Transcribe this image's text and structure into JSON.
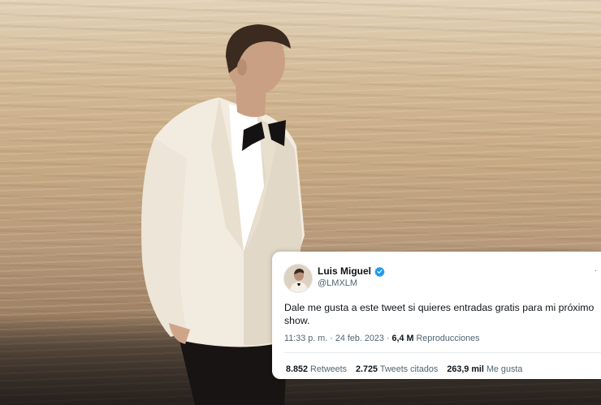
{
  "tweet": {
    "display_name": "Luis Miguel",
    "handle": "@LMXLM",
    "more_glyph": "·",
    "text": "Dale me gusta a este tweet si quieres entradas gratis para mi próximo show.",
    "time": "11:33 p. m.",
    "separator": "·",
    "date": "24 feb. 2023",
    "views_count": "6,4 M",
    "views_label": "Reproducciones",
    "stats": [
      {
        "count": "8.852",
        "label": "Retweets"
      },
      {
        "count": "2.725",
        "label": "Tweets citados"
      },
      {
        "count": "263,9 mil",
        "label": "Me gusta"
      }
    ],
    "verified_color": "#1d9bf0"
  },
  "scene": {
    "description_colors": {
      "sea_light": "#e2d2b8",
      "sea_dark": "#3a322c",
      "jacket": "#f3ece0"
    }
  }
}
